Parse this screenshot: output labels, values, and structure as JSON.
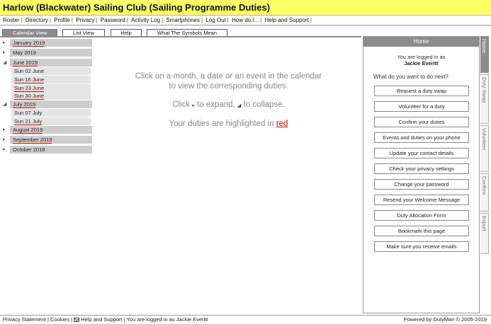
{
  "header": {
    "title": "Harlow (Blackwater) Sailing Club (Sailing Programme Duties)"
  },
  "menu": {
    "items": [
      "Roster",
      "Directory",
      "Profile",
      "Privacy",
      "Password",
      "Activity Log",
      "Log Out",
      "How do I...",
      "Help and Support"
    ],
    "smartphones": "Smartphones"
  },
  "tabs": {
    "calendar_view": "Calendar View",
    "list_view": "List View",
    "help": "Help",
    "symbols": "What The Symbols Mean"
  },
  "tree": {
    "expanded_glyph": "◢",
    "collapsed_glyph": "▸",
    "months": {
      "jan": "January 2019",
      "may": "May 2019",
      "jun": "June 2019",
      "jul": "July 2019",
      "aug": "August 2019",
      "sep": "September 2019",
      "oct": "October 2019"
    },
    "dates": {
      "jun02": "Sun 02 June",
      "jun16": "Sun 16 June",
      "jun23": "Sun 23 June",
      "jun30": "Sun 30 June",
      "jul07": "Sun 07 July",
      "jul21": "Sun 21 July"
    }
  },
  "instructions": {
    "line1": "Click on a month, a date or an event in the calendar",
    "line2": "to view the corresponding duties.",
    "click_prefix": "Click",
    "expand_text": "to expand,",
    "collapse_text": "to collapse.",
    "highlight_prefix": "Your duties are highlighted in",
    "highlight_word": "red"
  },
  "right_panel": {
    "title": "Home",
    "logged_label": "You are logged in as",
    "user_name": "Jackie Everitt",
    "question": "What do you want to do next?",
    "buttons": {
      "swap": "Request a duty swap",
      "volunteer": "Volunteer for a duty",
      "confirm": "Confirm your duties",
      "events": "Events and duties on your phone",
      "contact": "Update your contact details",
      "privacy": "Check your privacy settings",
      "password": "Change your password",
      "welcome": "Resend your Welcome Message",
      "allocation": "Duty Allocation Form",
      "bookmark": "Bookmark this page",
      "emails": "Make sure you receive emails"
    }
  },
  "side_tabs": {
    "home": "Home",
    "duty_swap": "Duty Swap",
    "volunteer": "Volunteer",
    "confirm": "Confirm",
    "export": "Export"
  },
  "footer": {
    "privacy": "Privacy Statement",
    "cookies": "Cookies",
    "help": "Help and Support",
    "logged": "You are logged in as Jackie Everitt",
    "powered": "Powered by DutyMan © 2005-2019"
  },
  "colors": {
    "header_bg": "#ffff66",
    "tab_active": "#8c8c8c",
    "duty_highlight": "#cc0000"
  }
}
